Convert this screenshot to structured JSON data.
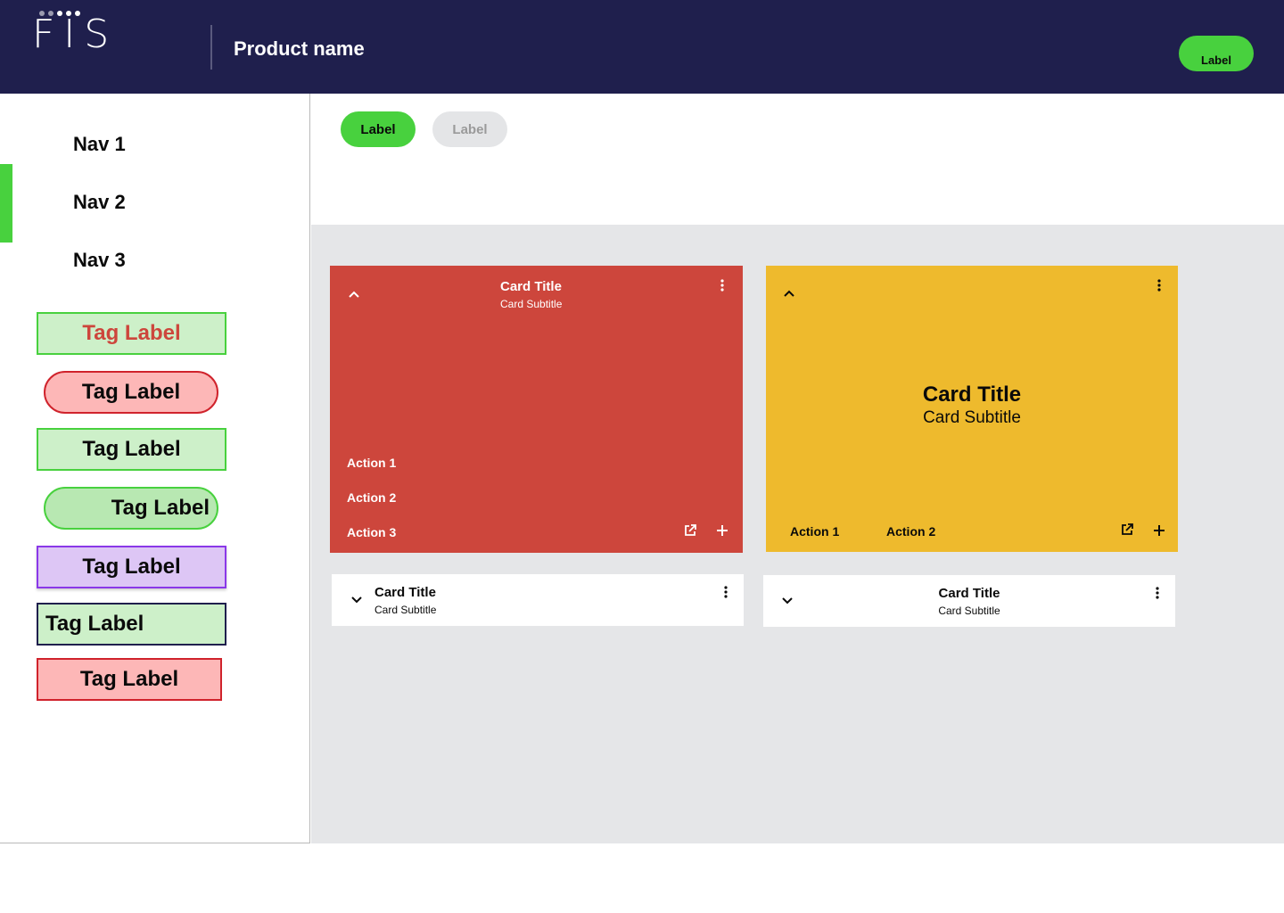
{
  "header": {
    "logo_text": "FIS",
    "product_name": "Product name",
    "button_label": "Label",
    "logo_icon": "fis-logo"
  },
  "sidebar": {
    "nav": [
      {
        "label": "Nav 1"
      },
      {
        "label": "Nav 2"
      },
      {
        "label": "Nav 3"
      }
    ],
    "active_index": 1,
    "tags": [
      {
        "label": "Tag Label"
      },
      {
        "label": "Tag Label"
      },
      {
        "label": "Tag Label"
      },
      {
        "label": "Tag Label"
      },
      {
        "label": "Tag Label"
      },
      {
        "label": "Tag Label"
      },
      {
        "label": "Tag Label"
      }
    ]
  },
  "toolbar": {
    "active_label": "Label",
    "disabled_label": "Label"
  },
  "cards": {
    "red": {
      "title": "Card Title",
      "subtitle": "Card Subtitle",
      "actions": [
        "Action 1",
        "Action 2",
        "Action 3"
      ],
      "color": "#cd463c"
    },
    "yellow": {
      "title": "Card Title",
      "subtitle": "Card Subtitle",
      "actions": [
        "Action 1",
        "Action 2"
      ],
      "color": "#eeba2d"
    },
    "collapsed_left": {
      "title": "Card Title",
      "subtitle": "Card Subtitle"
    },
    "collapsed_right": {
      "title": "Card Title",
      "subtitle": "Card Subtitle"
    }
  },
  "colors": {
    "header_bg": "#1f1f4d",
    "accent_green": "#48d13e",
    "content_bg": "#e5e6e8"
  }
}
